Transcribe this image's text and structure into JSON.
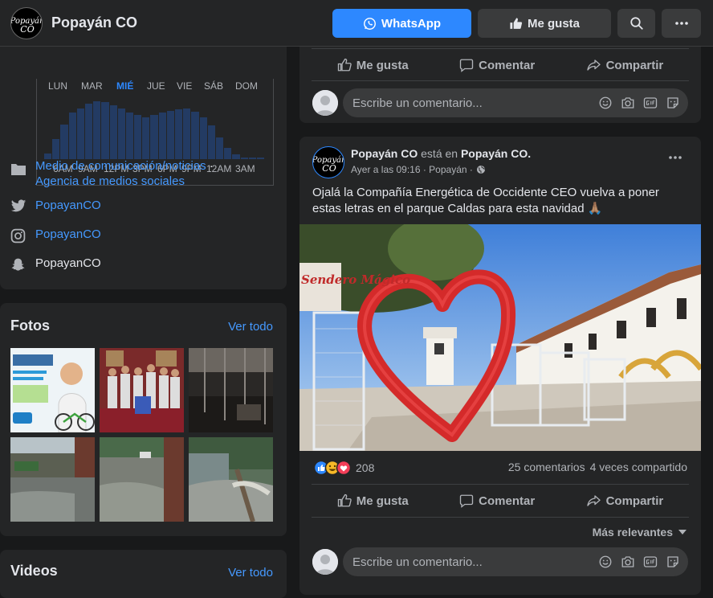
{
  "header": {
    "page_name": "Popayán CO",
    "whatsapp_label": "WhatsApp",
    "like_label": "Me gusta",
    "logo_text": "Popayán CO"
  },
  "about": {
    "days": [
      "LUN",
      "MAR",
      "MIÉ",
      "JUE",
      "VIE",
      "SÁB",
      "DOM"
    ],
    "active_day": "MIÉ",
    "hour_labels": [
      "6AM",
      "9AM",
      "12PM",
      "3PM",
      "6PM",
      "9PM",
      "12AM",
      "3AM"
    ],
    "activity_levels": [
      0.1,
      0.35,
      0.6,
      0.8,
      0.88,
      0.96,
      1.0,
      0.98,
      0.93,
      0.88,
      0.8,
      0.76,
      0.72,
      0.76,
      0.8,
      0.84,
      0.86,
      0.88,
      0.82,
      0.72,
      0.58,
      0.38,
      0.2,
      0.08,
      0.03,
      0.02,
      0.01
    ],
    "category_1": "Medio de comunicación/noticias",
    "category_sep": "·",
    "category_2": "Agencia de medios sociales",
    "twitter": "PopayanCO",
    "instagram": "PopayanCO",
    "snapchat": "PopayanCO"
  },
  "photos": {
    "title": "Fotos",
    "see_all": "Ver todo"
  },
  "videos": {
    "title": "Videos",
    "see_all": "Ver todo"
  },
  "post1": {
    "like": "Me gusta",
    "comment": "Comentar",
    "share": "Compartir",
    "comment_placeholder": "Escribe un comentario..."
  },
  "post2": {
    "author": "Popayán CO",
    "is_in": "está en",
    "location": "Popayán CO.",
    "time": "Ayer a las 09:16 · Popayán ·",
    "text": "Ojalá la Compañía Energética de Occidente CEO vuelva a poner estas letras en el parque Caldas para esta navidad 🙏🏽",
    "reactions_count": "208",
    "comments_count": "25 comentarios",
    "shares_count": "4 veces compartido",
    "like": "Me gusta",
    "comment": "Comentar",
    "share": "Compartir",
    "sort_label": "Más relevantes",
    "comment_placeholder": "Escribe un comentario...",
    "image_sign": "Sendero Mágico"
  },
  "colors": {
    "accent": "#2d88ff",
    "bg": "#18191a",
    "card": "#242526"
  }
}
